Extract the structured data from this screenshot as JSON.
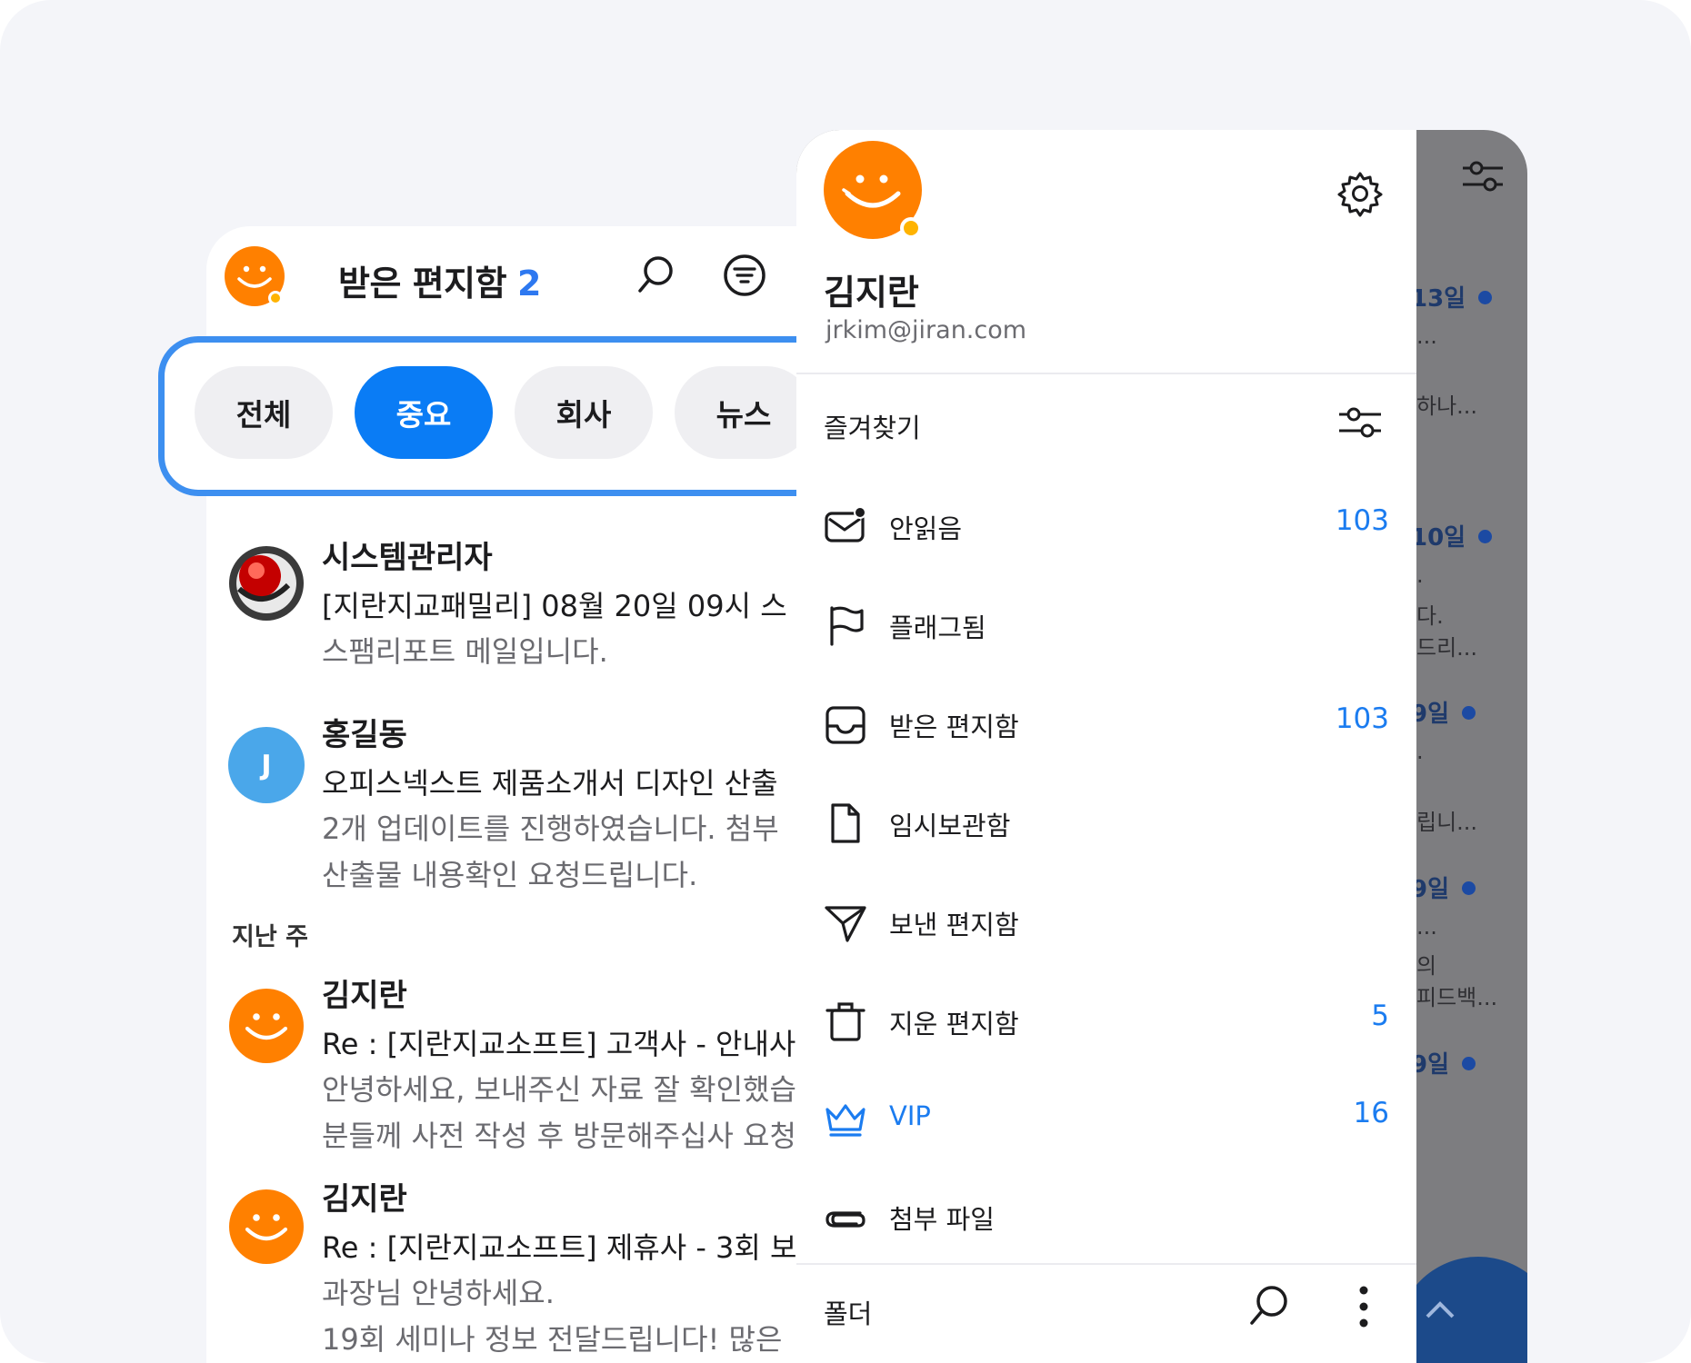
{
  "inbox": {
    "title": "받은 편지함",
    "count": "2",
    "section_last_week": "지난 주",
    "mails": [
      {
        "sender": "시스템관리자",
        "subject": "[지란지교패밀리] 08월 20일 09시 스",
        "preview": [
          "스팸리포트 메일입니다."
        ],
        "avatar": "system-avatar"
      },
      {
        "sender": "홍길동",
        "subject": "오피스넥스트 제품소개서 디자인 산출",
        "preview": [
          "2개 업데이트를 진행하였습니다. 첨부",
          "산출물 내용확인 요청드립니다."
        ],
        "avatar": "J"
      },
      {
        "sender": "김지란",
        "subject": "Re : [지란지교소프트] 고객사 - 안내사",
        "preview": [
          "안녕하세요, 보내주신 자료 잘 확인했습",
          "분들께 사전 작성 후 방문해주십사 요청"
        ],
        "avatar": "smiley"
      },
      {
        "sender": "김지란",
        "subject": "Re : [지란지교소프트] 제휴사 - 3회 보",
        "preview": [
          "과장님 안녕하세요.",
          "19회 세미나 정보 전달드립니다! 많은"
        ],
        "avatar": "smiley"
      }
    ]
  },
  "categories": [
    {
      "label": "전체",
      "active": false
    },
    {
      "label": "중요",
      "active": true
    },
    {
      "label": "회사",
      "active": false
    },
    {
      "label": "뉴스",
      "active": false
    }
  ],
  "background_list": {
    "dates": [
      "13일",
      "10일",
      "9일",
      "9일",
      "9일"
    ],
    "snippets": [
      "...",
      "하나...",
      ".",
      "다.",
      "드리...",
      ".",
      "립니...",
      "...",
      "의",
      "피드백..."
    ]
  },
  "drawer": {
    "user_name": "김지란",
    "user_email": "jrkim@jiran.com",
    "favorites_label": "즐겨찾기",
    "items": [
      {
        "label": "안읽음",
        "count": "103",
        "icon": "unread-mail-icon"
      },
      {
        "label": "플래그됨",
        "count": "",
        "icon": "flag-icon"
      },
      {
        "label": "받은 편지함",
        "count": "103",
        "icon": "inbox-tray-icon"
      },
      {
        "label": "임시보관함",
        "count": "",
        "icon": "draft-document-icon"
      },
      {
        "label": "보낸 편지함",
        "count": "",
        "icon": "send-icon"
      },
      {
        "label": "지운 편지함",
        "count": "5",
        "icon": "trash-icon"
      },
      {
        "label": "VIP",
        "count": "16",
        "icon": "crown-icon"
      },
      {
        "label": "첨부 파일",
        "count": "",
        "icon": "attachment-icon"
      }
    ],
    "folders_label": "폴더"
  },
  "colors": {
    "accent": "#1b7cf0",
    "chip_active": "#0a7cf5",
    "highlight_border": "#3d8ff0",
    "avatar_orange": "#ff8000"
  }
}
